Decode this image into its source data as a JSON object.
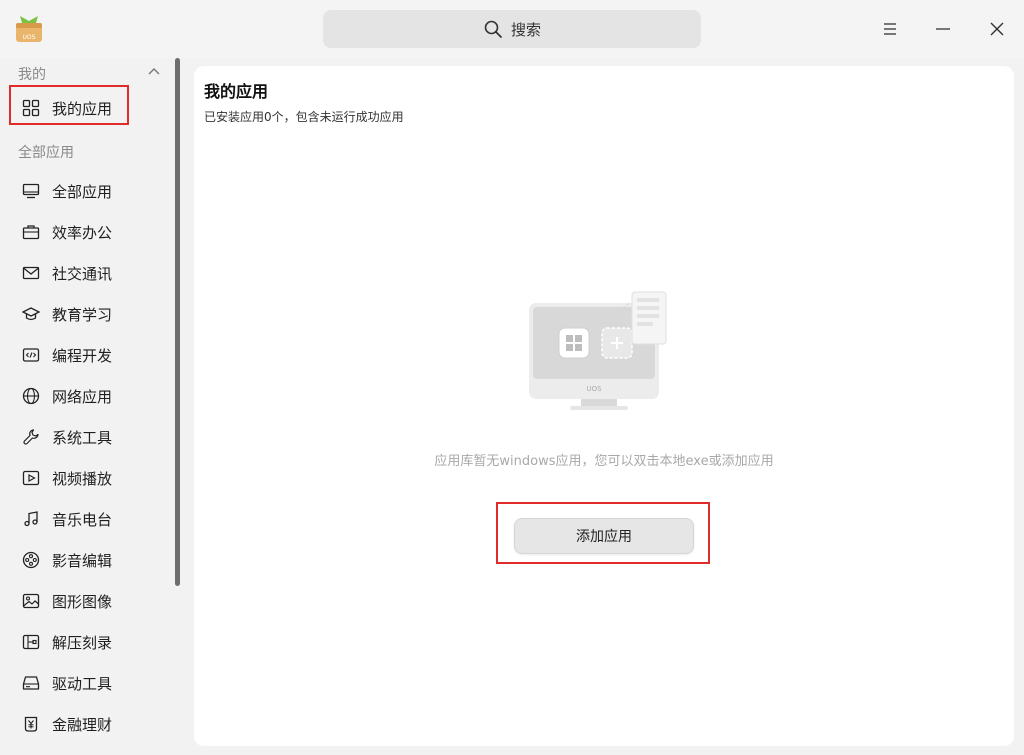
{
  "titlebar": {
    "logo_text": "UOS",
    "search_label": "搜索"
  },
  "sidebar": {
    "section_mine": "我的",
    "my_apps": {
      "label": "我的应用",
      "icon": "grid-icon"
    },
    "section_all": "全部应用",
    "items": [
      {
        "label": "全部应用",
        "icon": "monitor-icon"
      },
      {
        "label": "效率办公",
        "icon": "briefcase-icon"
      },
      {
        "label": "社交通讯",
        "icon": "mail-icon"
      },
      {
        "label": "教育学习",
        "icon": "graduation-cap-icon"
      },
      {
        "label": "编程开发",
        "icon": "code-icon"
      },
      {
        "label": "网络应用",
        "icon": "globe-icon"
      },
      {
        "label": "系统工具",
        "icon": "wrench-icon"
      },
      {
        "label": "视频播放",
        "icon": "video-play-icon"
      },
      {
        "label": "音乐电台",
        "icon": "music-note-icon"
      },
      {
        "label": "影音编辑",
        "icon": "film-reel-icon"
      },
      {
        "label": "图形图像",
        "icon": "image-icon"
      },
      {
        "label": "解压刻录",
        "icon": "archive-icon"
      },
      {
        "label": "驱动工具",
        "icon": "drive-icon"
      },
      {
        "label": "金融理财",
        "icon": "yen-icon"
      }
    ]
  },
  "main": {
    "title": "我的应用",
    "subtitle": "已安装应用0个，包含未运行成功应用",
    "illustration_label": "UOS",
    "empty_text": "应用库暂无windows应用，您可以双击本地exe或添加应用",
    "add_button": "添加应用"
  },
  "colors": {
    "highlight_red": "#e02b2b",
    "window_bg": "#f2f2f2",
    "content_bg": "#ffffff"
  }
}
